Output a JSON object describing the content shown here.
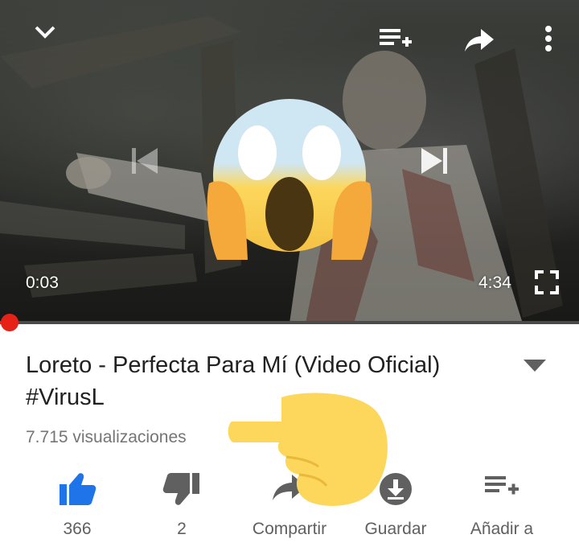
{
  "player": {
    "current_time": "0:03",
    "duration": "4:34",
    "progress": 0.011,
    "icons": {
      "collapse": "chevron-down-icon",
      "add_to_playlist": "playlist-add-icon",
      "share": "share-icon",
      "more": "more-vert-icon",
      "previous": "skip-previous-icon",
      "next": "skip-next-icon",
      "fullscreen": "fullscreen-icon"
    }
  },
  "video": {
    "title": "Loreto - Perfecta Para Mí (Video Oficial) #VirusL",
    "views": "7.715 visualizaciones"
  },
  "actions": [
    {
      "id": "like",
      "label": "366",
      "icon": "thumb-up-icon",
      "color": "#1e74e8"
    },
    {
      "id": "dislike",
      "label": "2",
      "icon": "thumb-down-icon",
      "color": "#606060"
    },
    {
      "id": "share",
      "label": "Compartir",
      "icon": "share-icon",
      "color": "#606060"
    },
    {
      "id": "save",
      "label": "Guardar",
      "icon": "download-icon",
      "color": "#606060"
    },
    {
      "id": "add",
      "label": "Añadir a",
      "icon": "playlist-add-icon",
      "color": "#606060"
    }
  ],
  "overlays": {
    "scream_emoji": "screaming-face-emoji",
    "pointing_hand": "pointing-hand-emoji"
  },
  "colors": {
    "progress": "#e62117",
    "like_blue": "#1e74e8",
    "emoji_yellow": "#fcd75c"
  }
}
